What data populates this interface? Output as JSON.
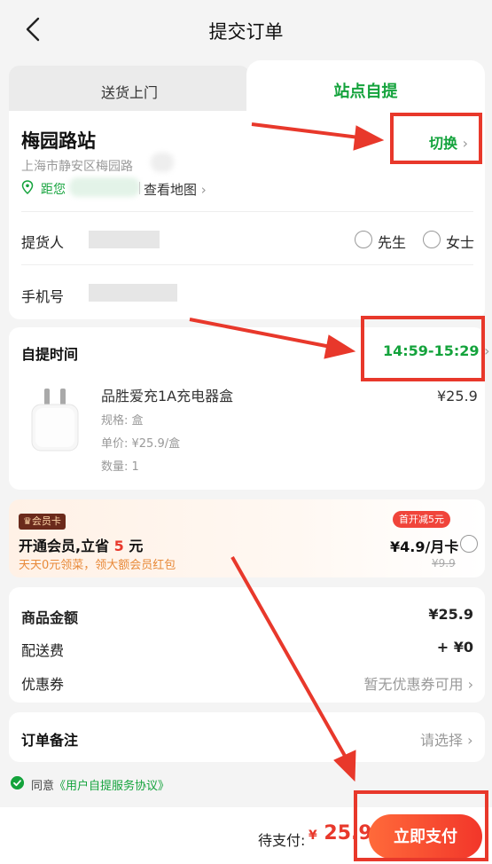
{
  "header": {
    "title": "提交订单",
    "back_icon": "chevron-left-icon"
  },
  "tabs": [
    {
      "label": "送货上门",
      "active": false
    },
    {
      "label": "站点自提",
      "active": true
    }
  ],
  "station": {
    "name": "梅园路站",
    "address": "上海市静安区梅园路",
    "distance_prefix": "距您",
    "map_link": "查看地图",
    "switch_label": "切换"
  },
  "form": {
    "pickup_person_label": "提货人",
    "phone_label": "手机号",
    "title_options": [
      "先生",
      "女士"
    ]
  },
  "pickup": {
    "section_title": "自提时间",
    "time": "14:59-15:29"
  },
  "product": {
    "name": "品胜爱充1A充电器盒",
    "spec": "规格: 盒",
    "unit_price": "单价: ¥25.9/盒",
    "quantity": "数量: 1",
    "price": "¥25.9"
  },
  "member": {
    "badge": "会员卡",
    "title_prefix": "开通会员,立省",
    "title_amount": "5",
    "title_suffix": "元",
    "subtitle": "天天0元领菜，领大额会员红包",
    "promo_tag": "首开减5元",
    "price": "¥4.9/月卡",
    "original_price": "¥9.9"
  },
  "summary": {
    "goods_label": "商品金额",
    "goods_value": "¥25.9",
    "delivery_label": "配送费",
    "delivery_value": "+ ¥0",
    "coupon_label": "优惠券",
    "coupon_value": "暂无优惠券可用"
  },
  "notes": {
    "label": "订单备注",
    "placeholder": "请选择"
  },
  "agreement": {
    "prefix": "同意",
    "link": "《用户自提服务协议》"
  },
  "footer": {
    "pay_label": "待支付:",
    "currency": "¥",
    "amount": "25.9",
    "pay_button": "立即支付"
  },
  "colors": {
    "accent_green": "#14a33c",
    "accent_red": "#e8382b",
    "annotation_red": "#e8382b"
  }
}
